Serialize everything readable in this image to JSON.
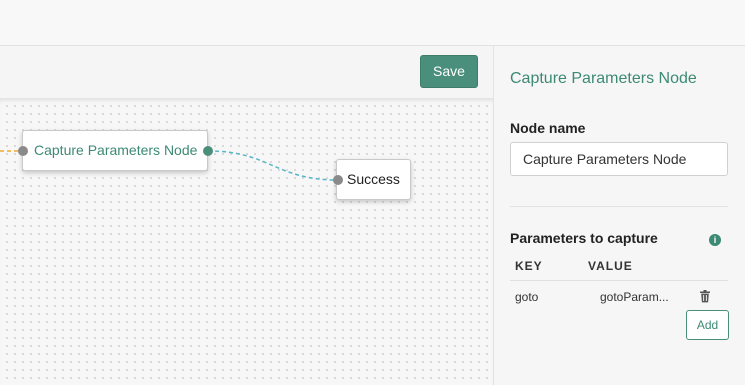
{
  "toolbar": {
    "save_label": "Save"
  },
  "canvas": {
    "nodes": {
      "capture": {
        "label": "Capture Parameters Node"
      },
      "success": {
        "label": "Success"
      }
    }
  },
  "panel": {
    "title": "Capture Parameters Node",
    "node_name_label": "Node name",
    "node_name_value": "Capture Parameters Node",
    "params_label": "Parameters to capture",
    "info_glyph": "i",
    "columns": {
      "key": "KEY",
      "value": "VALUE"
    },
    "rows": [
      {
        "key": "goto",
        "value": "gotoParam..."
      }
    ],
    "add_label": "Add"
  },
  "colors": {
    "accent": "#4a8f7b",
    "accent_text": "#3d8a74",
    "edge_success": "#5ab4c9",
    "edge_incoming": "#f0a830"
  },
  "icons": [
    "info-icon",
    "trash-icon"
  ]
}
